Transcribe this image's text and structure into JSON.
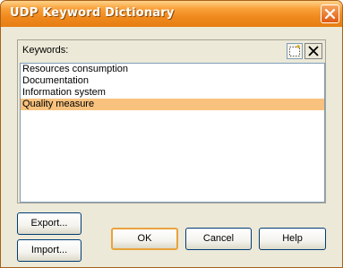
{
  "window": {
    "title": "UDP Keyword Dictionary"
  },
  "keywords": {
    "label": "Keywords:",
    "items": [
      {
        "label": "Resources consumption",
        "selected": false
      },
      {
        "label": "Documentation",
        "selected": false
      },
      {
        "label": "Information system",
        "selected": false
      },
      {
        "label": "Quality measure",
        "selected": true
      }
    ]
  },
  "buttons": {
    "export": "Export...",
    "import": "Import...",
    "ok": "OK",
    "cancel": "Cancel",
    "help": "Help"
  },
  "icons": {
    "close": "close-icon",
    "new": "new-item-icon",
    "delete": "delete-icon"
  },
  "colors": {
    "titlebar": "#f08a1e",
    "selection": "#f8c27e",
    "dialog_bg": "#ece9d8"
  }
}
